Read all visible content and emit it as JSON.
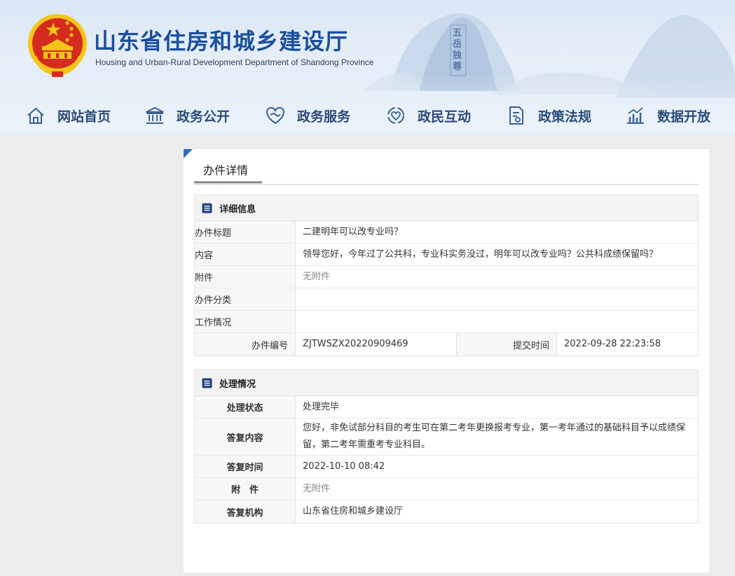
{
  "header": {
    "title": "山东省住房和城乡建设厅",
    "subtitle": "Housing and Urban-Rural Development Department of Shandong Province",
    "seal_text": "五岳独尊"
  },
  "nav": [
    {
      "label": "网站首页",
      "icon": "home-icon"
    },
    {
      "label": "政务公开",
      "icon": "government-building-icon"
    },
    {
      "label": "政务服务",
      "icon": "handshake-icon"
    },
    {
      "label": "政民互动",
      "icon": "interaction-icon"
    },
    {
      "label": "政策法规",
      "icon": "document-icon"
    },
    {
      "label": "数据开放",
      "icon": "chart-icon"
    }
  ],
  "panel": {
    "tab_label": "办件详情"
  },
  "details": {
    "section_title": "详细信息",
    "rows": [
      {
        "label": "办件标题",
        "value": "二建明年可以改专业吗？"
      },
      {
        "label": "内容",
        "value": "领导您好，今年过了公共科，专业科实务没过，明年可以改专业吗？公共科成绩保留吗？"
      },
      {
        "label": "附件",
        "value": "无附件"
      },
      {
        "label": "办件分类",
        "value": ""
      },
      {
        "label": "工作情况",
        "value": ""
      }
    ],
    "id_label": "办件编号",
    "id_value": "ZJTWSZX20220909469",
    "submit_label": "提交时间",
    "submit_value": "2022-09-28 22:23:58"
  },
  "processing": {
    "section_title": "处理情况",
    "rows": [
      {
        "label": "处理状态",
        "value": "处理完毕"
      },
      {
        "label": "答复内容",
        "value": "您好，非免试部分科目的考生可在第二考年更换报考专业，第一考年通过的基础科目予以成绩保留，第二考年需重考专业科目。"
      },
      {
        "label": "答复时间",
        "value": "2022-10-10 08:42"
      },
      {
        "label": "附　件",
        "value": "无附件"
      },
      {
        "label": "答复机构",
        "value": "山东省住房和城乡建设厅"
      }
    ]
  },
  "colors": {
    "title_blue": "#1a4f9c",
    "nav_text": "#2a4a78",
    "accent_blue": "#2f6bc4",
    "emblem_red": "#d52b1e",
    "emblem_gold": "#f5c518"
  }
}
